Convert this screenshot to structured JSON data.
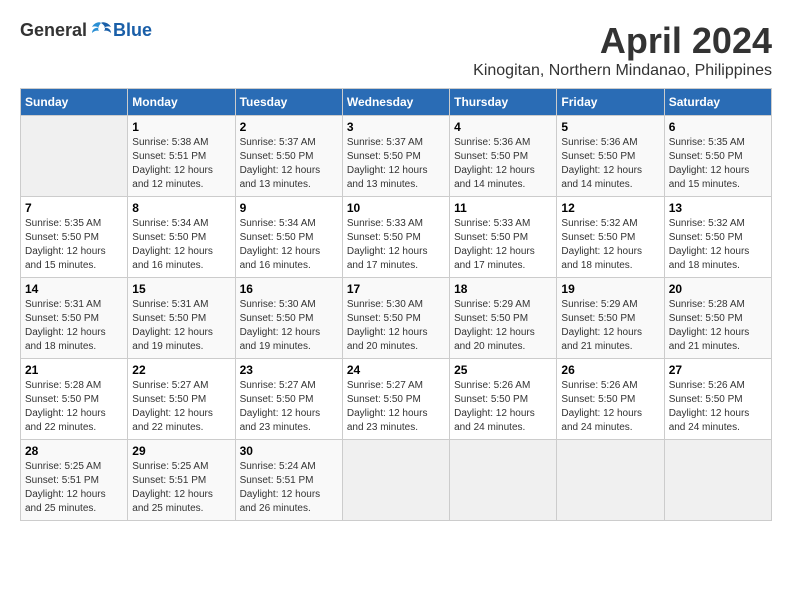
{
  "header": {
    "logo_general": "General",
    "logo_blue": "Blue",
    "month_year": "April 2024",
    "location": "Kinogitan, Northern Mindanao, Philippines"
  },
  "weekdays": [
    "Sunday",
    "Monday",
    "Tuesday",
    "Wednesday",
    "Thursday",
    "Friday",
    "Saturday"
  ],
  "weeks": [
    [
      {
        "day": "",
        "empty": true
      },
      {
        "day": "1",
        "sunrise": "5:38 AM",
        "sunset": "5:51 PM",
        "daylight": "12 hours and 12 minutes."
      },
      {
        "day": "2",
        "sunrise": "5:37 AM",
        "sunset": "5:50 PM",
        "daylight": "12 hours and 13 minutes."
      },
      {
        "day": "3",
        "sunrise": "5:37 AM",
        "sunset": "5:50 PM",
        "daylight": "12 hours and 13 minutes."
      },
      {
        "day": "4",
        "sunrise": "5:36 AM",
        "sunset": "5:50 PM",
        "daylight": "12 hours and 14 minutes."
      },
      {
        "day": "5",
        "sunrise": "5:36 AM",
        "sunset": "5:50 PM",
        "daylight": "12 hours and 14 minutes."
      },
      {
        "day": "6",
        "sunrise": "5:35 AM",
        "sunset": "5:50 PM",
        "daylight": "12 hours and 15 minutes."
      }
    ],
    [
      {
        "day": "7",
        "sunrise": "5:35 AM",
        "sunset": "5:50 PM",
        "daylight": "12 hours and 15 minutes."
      },
      {
        "day": "8",
        "sunrise": "5:34 AM",
        "sunset": "5:50 PM",
        "daylight": "12 hours and 16 minutes."
      },
      {
        "day": "9",
        "sunrise": "5:34 AM",
        "sunset": "5:50 PM",
        "daylight": "12 hours and 16 minutes."
      },
      {
        "day": "10",
        "sunrise": "5:33 AM",
        "sunset": "5:50 PM",
        "daylight": "12 hours and 17 minutes."
      },
      {
        "day": "11",
        "sunrise": "5:33 AM",
        "sunset": "5:50 PM",
        "daylight": "12 hours and 17 minutes."
      },
      {
        "day": "12",
        "sunrise": "5:32 AM",
        "sunset": "5:50 PM",
        "daylight": "12 hours and 18 minutes."
      },
      {
        "day": "13",
        "sunrise": "5:32 AM",
        "sunset": "5:50 PM",
        "daylight": "12 hours and 18 minutes."
      }
    ],
    [
      {
        "day": "14",
        "sunrise": "5:31 AM",
        "sunset": "5:50 PM",
        "daylight": "12 hours and 18 minutes."
      },
      {
        "day": "15",
        "sunrise": "5:31 AM",
        "sunset": "5:50 PM",
        "daylight": "12 hours and 19 minutes."
      },
      {
        "day": "16",
        "sunrise": "5:30 AM",
        "sunset": "5:50 PM",
        "daylight": "12 hours and 19 minutes."
      },
      {
        "day": "17",
        "sunrise": "5:30 AM",
        "sunset": "5:50 PM",
        "daylight": "12 hours and 20 minutes."
      },
      {
        "day": "18",
        "sunrise": "5:29 AM",
        "sunset": "5:50 PM",
        "daylight": "12 hours and 20 minutes."
      },
      {
        "day": "19",
        "sunrise": "5:29 AM",
        "sunset": "5:50 PM",
        "daylight": "12 hours and 21 minutes."
      },
      {
        "day": "20",
        "sunrise": "5:28 AM",
        "sunset": "5:50 PM",
        "daylight": "12 hours and 21 minutes."
      }
    ],
    [
      {
        "day": "21",
        "sunrise": "5:28 AM",
        "sunset": "5:50 PM",
        "daylight": "12 hours and 22 minutes."
      },
      {
        "day": "22",
        "sunrise": "5:27 AM",
        "sunset": "5:50 PM",
        "daylight": "12 hours and 22 minutes."
      },
      {
        "day": "23",
        "sunrise": "5:27 AM",
        "sunset": "5:50 PM",
        "daylight": "12 hours and 23 minutes."
      },
      {
        "day": "24",
        "sunrise": "5:27 AM",
        "sunset": "5:50 PM",
        "daylight": "12 hours and 23 minutes."
      },
      {
        "day": "25",
        "sunrise": "5:26 AM",
        "sunset": "5:50 PM",
        "daylight": "12 hours and 24 minutes."
      },
      {
        "day": "26",
        "sunrise": "5:26 AM",
        "sunset": "5:50 PM",
        "daylight": "12 hours and 24 minutes."
      },
      {
        "day": "27",
        "sunrise": "5:26 AM",
        "sunset": "5:50 PM",
        "daylight": "12 hours and 24 minutes."
      }
    ],
    [
      {
        "day": "28",
        "sunrise": "5:25 AM",
        "sunset": "5:51 PM",
        "daylight": "12 hours and 25 minutes."
      },
      {
        "day": "29",
        "sunrise": "5:25 AM",
        "sunset": "5:51 PM",
        "daylight": "12 hours and 25 minutes."
      },
      {
        "day": "30",
        "sunrise": "5:24 AM",
        "sunset": "5:51 PM",
        "daylight": "12 hours and 26 minutes."
      },
      {
        "day": "",
        "empty": true
      },
      {
        "day": "",
        "empty": true
      },
      {
        "day": "",
        "empty": true
      },
      {
        "day": "",
        "empty": true
      }
    ]
  ]
}
